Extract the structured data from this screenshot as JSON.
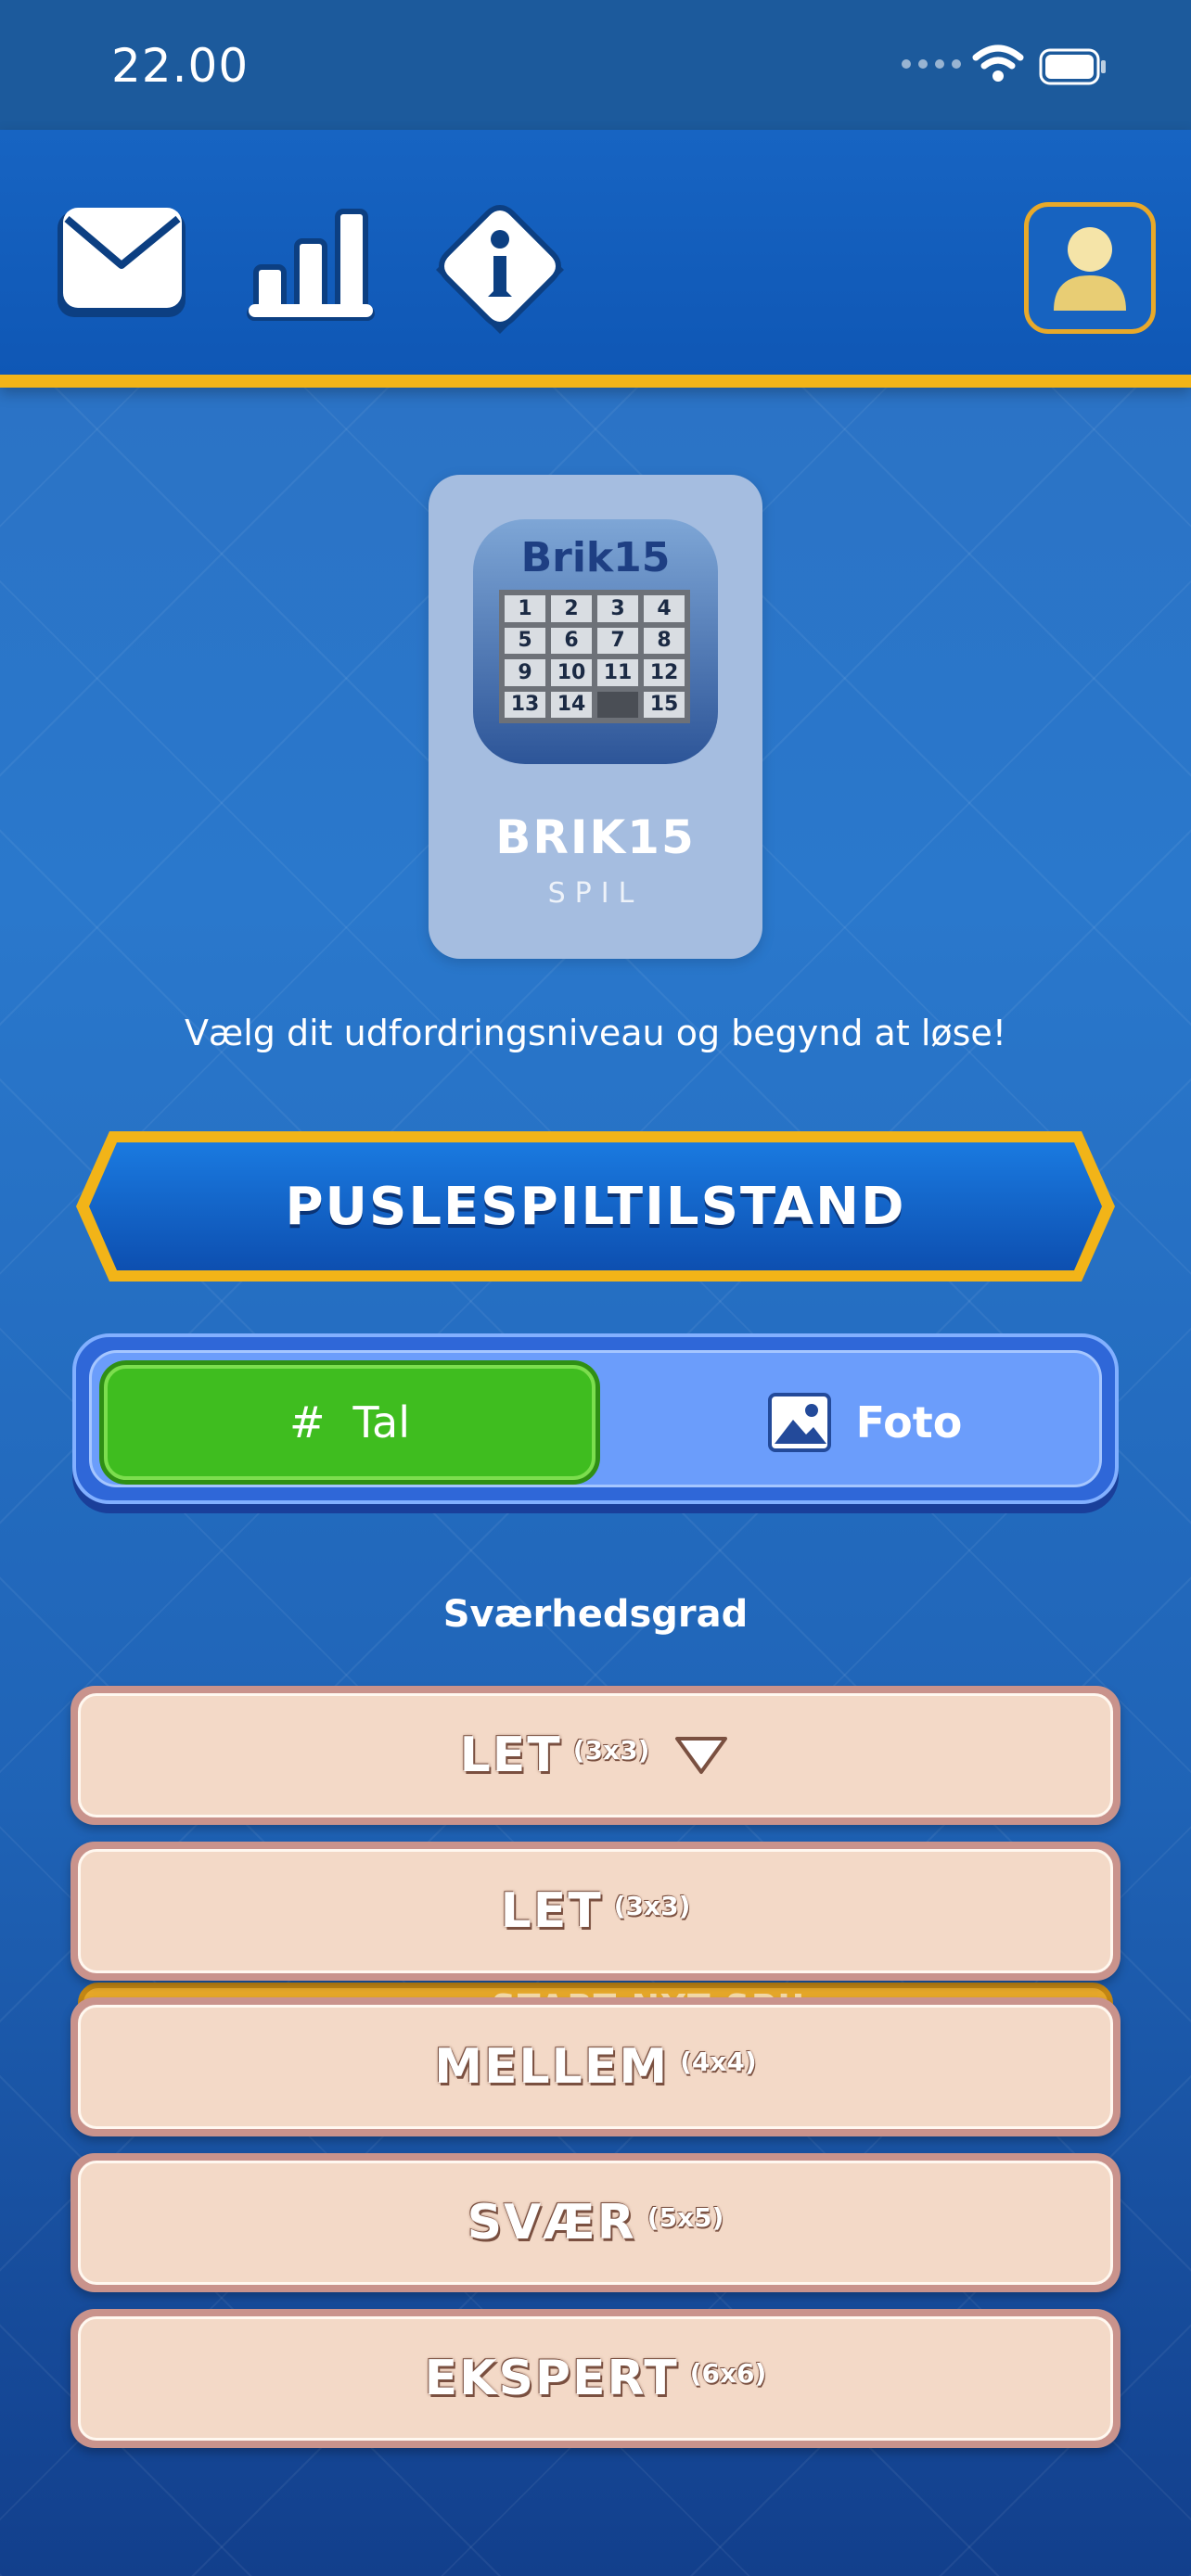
{
  "status_bar": {
    "time": "22.00"
  },
  "header": {
    "buttons": [
      {
        "name": "mail",
        "icon": "mail-icon"
      },
      {
        "name": "stats",
        "icon": "bar-chart-icon"
      },
      {
        "name": "info",
        "icon": "info-icon"
      },
      {
        "name": "profile",
        "icon": "user-icon"
      }
    ],
    "accent_color": "#f2b418"
  },
  "game_card": {
    "icon_title": "Brik15",
    "icon_tiles": [
      "1",
      "2",
      "3",
      "4",
      "5",
      "6",
      "7",
      "8",
      "9",
      "10",
      "11",
      "12",
      "13",
      "14",
      "",
      "15"
    ],
    "name": "BRIK15",
    "subtitle": "SPIL"
  },
  "intro_text": "Vælg dit udfordringsniveau og begynd at løse!",
  "mode_banner": {
    "label": "PUSLESPILTILSTAND"
  },
  "mode_toggle": {
    "options": [
      {
        "label": "Tal",
        "symbol": "#",
        "selected": true
      },
      {
        "label": "Foto",
        "icon": "image-icon",
        "selected": false
      }
    ]
  },
  "difficulty": {
    "label": "Sværhedsgrad",
    "selected": {
      "label": "LET",
      "size": "(3x3)"
    },
    "options": [
      {
        "label": "LET",
        "size": "(3x3)"
      },
      {
        "label": "MELLEM",
        "size": "(4x4)"
      },
      {
        "label": "SVÆR",
        "size": "(5x5)"
      },
      {
        "label": "EKSPERT",
        "size": "(6x6)"
      }
    ]
  },
  "start_button": {
    "label": "START NYT SPIL"
  }
}
